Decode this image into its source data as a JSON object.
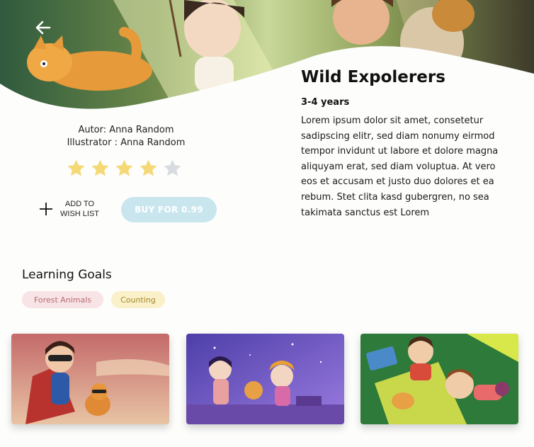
{
  "header": {
    "back_icon": "arrow-left-icon"
  },
  "book": {
    "title": "Wild Expolerers",
    "age": "3-4 years",
    "author": "Autor: Anna Random",
    "illustrator": "Illustrator : Anna Random",
    "rating": 4,
    "rating_max": 5,
    "description": "Lorem ipsum dolor sit amet, consetetur sadipscing elitr, sed diam nonumy eirmod tempor invidunt ut labore et dolore magna aliquyam erat, sed diam voluptua. At vero eos et accusam et justo duo dolores et ea rebum. Stet clita kasd gubergren, no sea takimata sanctus est Lorem"
  },
  "actions": {
    "wishlist_line1": "ADD TO",
    "wishlist_line2": "WISH LIST",
    "buy_label": "BUY FOR 0.99"
  },
  "learning_goals": {
    "heading": "Learning Goals",
    "tags": [
      "Forest Animals",
      "Counting"
    ]
  },
  "colors": {
    "buy_button": "#c9e6ef",
    "star_filled": "#f5d977",
    "star_empty": "#d8dce0",
    "tag_pink_bg": "#f8e4e6",
    "tag_yellow_bg": "#faf0c9"
  }
}
